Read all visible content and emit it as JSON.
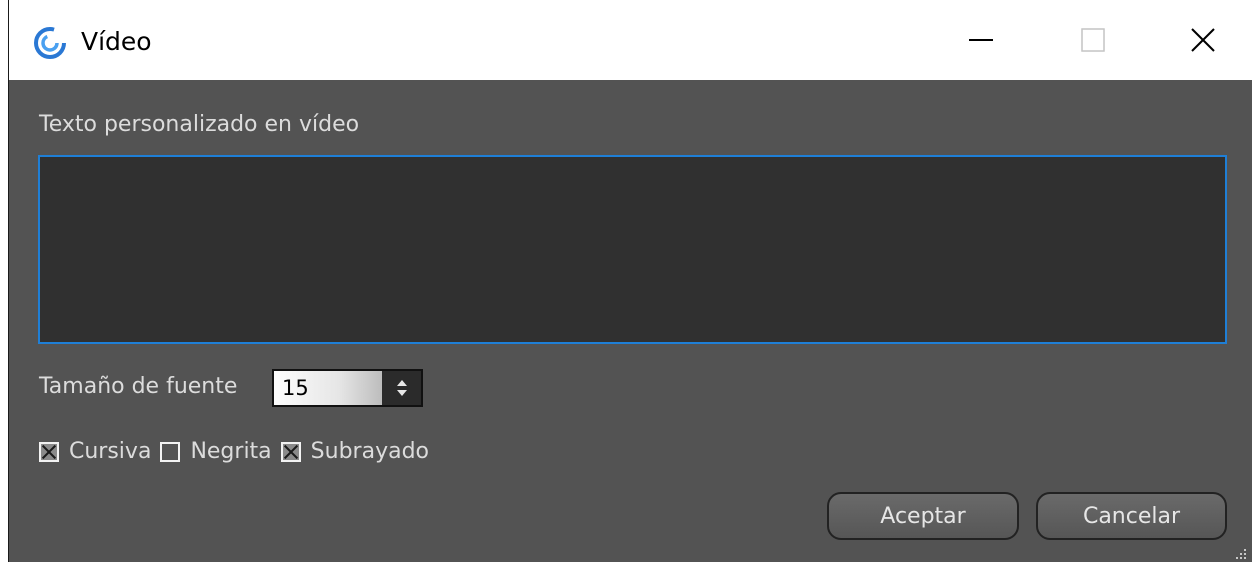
{
  "window": {
    "title": "Vídeo",
    "icon": "spiral-app-icon",
    "controls": [
      "minimize-icon",
      "maximize-icon",
      "close-icon"
    ]
  },
  "dialog": {
    "custom_text_label": "Texto personalizado en vídeo",
    "custom_text_value": "",
    "font_size_label": "Tamaño de fuente",
    "font_size_value": "15",
    "checkboxes": [
      {
        "label": "Cursiva",
        "checked": true
      },
      {
        "label": "Negrita",
        "checked": false
      },
      {
        "label": "Subrayado",
        "checked": true
      }
    ],
    "accept_label": "Aceptar",
    "cancel_label": "Cancelar"
  },
  "colors": {
    "dialog_background": "#535353",
    "textarea_background": "#303030",
    "focus_border": "#1f7fd6",
    "text": "#dcdcdc"
  }
}
